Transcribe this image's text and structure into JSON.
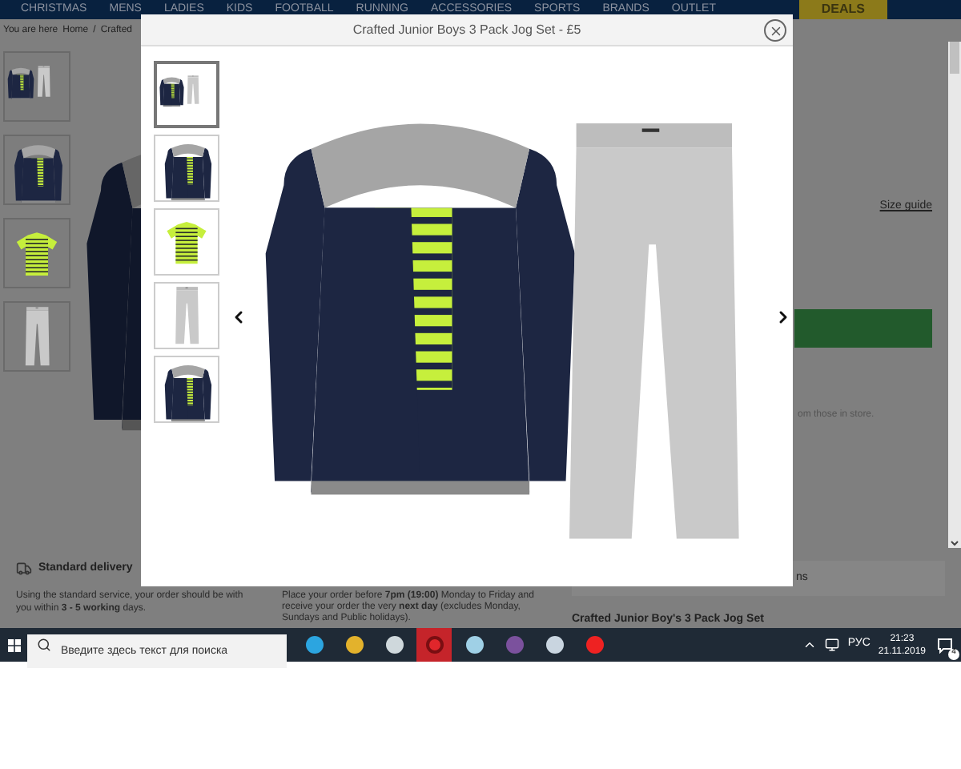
{
  "nav": {
    "items": [
      {
        "label": "CHRISTMAS",
        "kind": "link"
      },
      {
        "label": "MENS",
        "kind": "link"
      },
      {
        "label": "LADIES",
        "kind": "link"
      },
      {
        "label": "KIDS",
        "kind": "link"
      },
      {
        "label": "FOOTBALL",
        "kind": "link"
      },
      {
        "label": "RUNNING",
        "kind": "link"
      },
      {
        "label": "ACCESSORIES",
        "kind": "link"
      },
      {
        "label": "SPORTS",
        "kind": "link"
      },
      {
        "label": "BRANDS",
        "kind": "link"
      },
      {
        "label": "OUTLET",
        "kind": "link"
      },
      {
        "label": "DEALS",
        "kind": "promo"
      }
    ]
  },
  "breadcrumb": {
    "lead": "You are here",
    "separator": "/",
    "items": [
      "Home",
      "Crafted"
    ]
  },
  "page_thumbnails": [
    {
      "kind": "set"
    },
    {
      "kind": "hoodie"
    },
    {
      "kind": "tee"
    },
    {
      "kind": "pants"
    }
  ],
  "size_guide": "Size guide",
  "store_note": "om those in store.",
  "delivery": {
    "title": "Standard delivery",
    "text": "Using the standard service, your order should be with you within **3 - 5 working** days."
  },
  "next_day": {
    "text": "Place your order before **7pm (19:00)** Monday to Friday and receive your order the very **next day** (excludes Monday, Sundays and Public holidays)."
  },
  "side_panel": {
    "tab": "ns",
    "product_name": "Crafted Junior Boy's 3 Pack Jog Set"
  },
  "modal": {
    "title": "Crafted Junior Boys 3 Pack Jog Set - £5",
    "thumbnails": [
      {
        "kind": "set",
        "selected": true
      },
      {
        "kind": "hoodie",
        "selected": false
      },
      {
        "kind": "tee",
        "selected": false
      },
      {
        "kind": "pants",
        "selected": false
      },
      {
        "kind": "hoodie",
        "selected": false
      }
    ]
  },
  "taskbar": {
    "search_placeholder": "Введите здесь текст для поиска",
    "apps": [
      {
        "kind": "telegram",
        "selected": false
      },
      {
        "kind": "chrome",
        "selected": false
      },
      {
        "kind": "paint",
        "selected": false
      },
      {
        "kind": "opera",
        "selected": true
      },
      {
        "kind": "notepad",
        "selected": false
      },
      {
        "kind": "viber",
        "selected": false
      },
      {
        "kind": "files",
        "selected": false
      },
      {
        "kind": "record",
        "selected": false
      }
    ],
    "language": "РУС",
    "time": "21:23",
    "date": "21.11.2019",
    "notifications": "4"
  }
}
